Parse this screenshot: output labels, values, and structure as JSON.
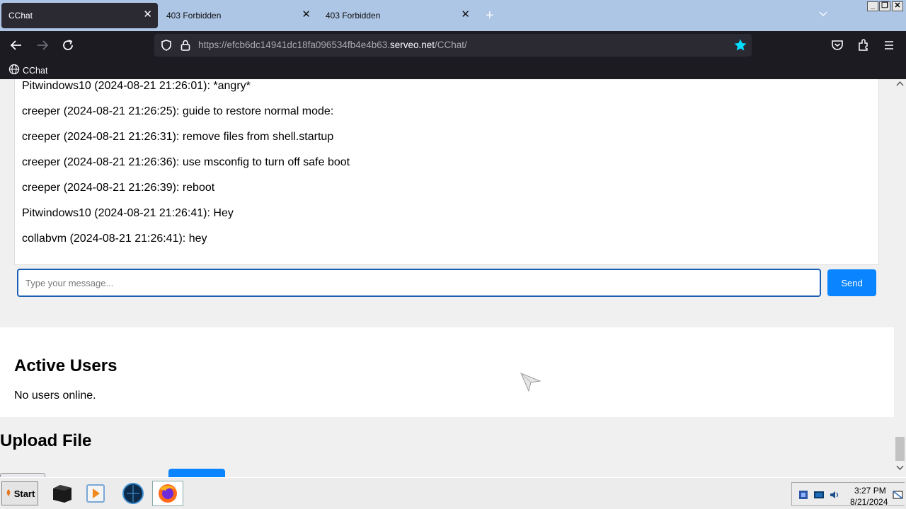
{
  "browser": {
    "tabs": [
      {
        "label": "CChat",
        "active": true
      },
      {
        "label": "403 Forbidden",
        "active": false
      },
      {
        "label": "403 Forbidden",
        "active": false
      }
    ],
    "url": {
      "prefix": "https://efcb6dc14941dc18fa096534fb4e4b63.",
      "host": "serveo.net",
      "path": "/CChat/"
    },
    "bookmark": "CChat"
  },
  "chat": {
    "messages": [
      "Pitwindows10 (2024-08-21 21:26:01): *angry*",
      "creeper (2024-08-21 21:26:25): guide to restore normal mode:",
      "creeper (2024-08-21 21:26:31): remove files from shell.startup",
      "creeper (2024-08-21 21:26:36): use msconfig to turn off safe boot",
      "creeper (2024-08-21 21:26:39): reboot",
      "Pitwindows10 (2024-08-21 21:26:41): Hey",
      "collabvm (2024-08-21 21:26:41): hey"
    ],
    "input_placeholder": "Type your message...",
    "send_label": "Send"
  },
  "users": {
    "title": "Active Users",
    "status": "No users online."
  },
  "upload": {
    "title": "Upload File"
  },
  "taskbar": {
    "start_label": "Start",
    "time": "3:27 PM",
    "date": "8/21/2024"
  },
  "colors": {
    "accent": "#0a84ff",
    "tabstrip": "#aec6e6",
    "toolbar": "#1c1b22",
    "star": "#00ddff"
  }
}
